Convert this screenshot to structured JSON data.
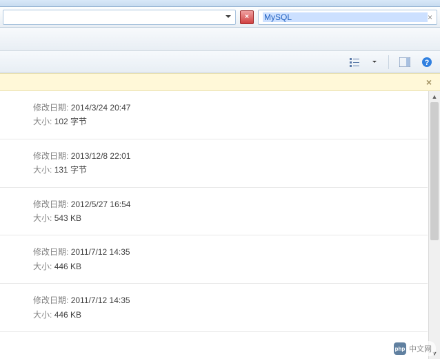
{
  "search": {
    "value": "MySQL",
    "clear": "×"
  },
  "close_btn": "×",
  "notice": {
    "close": "×"
  },
  "files": [
    {
      "date_label": "修改日期:",
      "date": "2014/3/24 20:47",
      "size_label": "大小:",
      "size": "102 字节"
    },
    {
      "date_label": "修改日期:",
      "date": "2013/12/8 22:01",
      "size_label": "大小:",
      "size": "131 字节"
    },
    {
      "date_label": "修改日期:",
      "date": "2012/5/27 16:54",
      "size_label": "大小:",
      "size": "543 KB"
    },
    {
      "date_label": "修改日期:",
      "date": "2011/7/12 14:35",
      "size_label": "大小:",
      "size": "446 KB"
    },
    {
      "date_label": "修改日期:",
      "date": "2011/7/12 14:35",
      "size_label": "大小:",
      "size": "446 KB"
    }
  ],
  "watermark": {
    "logo": "php",
    "text": "中文网"
  }
}
